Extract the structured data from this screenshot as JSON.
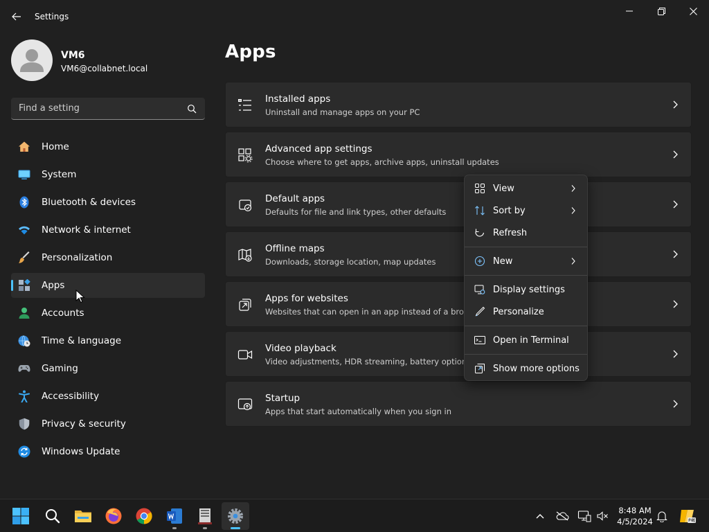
{
  "window": {
    "title": "Settings"
  },
  "profile": {
    "name": "VM6",
    "email": "VM6@collabnet.local"
  },
  "search": {
    "placeholder": "Find a setting"
  },
  "sidebar": {
    "items": [
      {
        "label": "Home",
        "icon": "home-icon"
      },
      {
        "label": "System",
        "icon": "system-icon"
      },
      {
        "label": "Bluetooth & devices",
        "icon": "bluetooth-icon"
      },
      {
        "label": "Network & internet",
        "icon": "wifi-icon"
      },
      {
        "label": "Personalization",
        "icon": "brush-icon"
      },
      {
        "label": "Apps",
        "icon": "apps-icon",
        "active": true
      },
      {
        "label": "Accounts",
        "icon": "accounts-icon"
      },
      {
        "label": "Time & language",
        "icon": "globe-clock-icon"
      },
      {
        "label": "Gaming",
        "icon": "gamepad-icon"
      },
      {
        "label": "Accessibility",
        "icon": "accessibility-icon"
      },
      {
        "label": "Privacy & security",
        "icon": "shield-icon"
      },
      {
        "label": "Windows Update",
        "icon": "update-icon"
      }
    ]
  },
  "main": {
    "title": "Apps",
    "cards": [
      {
        "title": "Installed apps",
        "desc": "Uninstall and manage apps on your PC",
        "icon": "list-icon"
      },
      {
        "title": "Advanced app settings",
        "desc": "Choose where to get apps, archive apps, uninstall updates",
        "icon": "app-settings-icon"
      },
      {
        "title": "Default apps",
        "desc": "Defaults for file and link types, other defaults",
        "icon": "default-apps-icon"
      },
      {
        "title": "Offline maps",
        "desc": "Downloads, storage location, map updates",
        "icon": "map-icon"
      },
      {
        "title": "Apps for websites",
        "desc": "Websites that can open in an app instead of a browse",
        "icon": "open-external-icon"
      },
      {
        "title": "Video playback",
        "desc": "Video adjustments, HDR streaming, battery options",
        "icon": "video-icon"
      },
      {
        "title": "Startup",
        "desc": "Apps that start automatically when you sign in",
        "icon": "startup-icon"
      }
    ]
  },
  "context_menu": {
    "items": [
      {
        "label": "View",
        "icon": "view-grid-icon",
        "submenu": true
      },
      {
        "label": "Sort by",
        "icon": "sort-icon",
        "submenu": true
      },
      {
        "label": "Refresh",
        "icon": "refresh-icon",
        "submenu": false
      },
      {
        "label": "New",
        "icon": "new-plus-icon",
        "submenu": true
      },
      {
        "label": "Display settings",
        "icon": "display-settings-icon",
        "submenu": false
      },
      {
        "label": "Personalize",
        "icon": "pen-icon",
        "submenu": false
      },
      {
        "label": "Open in Terminal",
        "icon": "terminal-icon",
        "submenu": false
      },
      {
        "label": "Show more options",
        "icon": "more-options-icon",
        "submenu": false
      }
    ]
  },
  "taskbar": {
    "apps": [
      "start-icon",
      "search-icon",
      "file-explorer-icon",
      "firefox-icon",
      "chrome-icon",
      "word-icon",
      "server-app-icon",
      "settings-gear-icon"
    ],
    "time": "8:48 AM",
    "date": "4/5/2024"
  },
  "colors": {
    "background": "#202020",
    "card": "#2b2b2b",
    "accent": "#4cc2ff",
    "menu": "#2c2c2c"
  }
}
